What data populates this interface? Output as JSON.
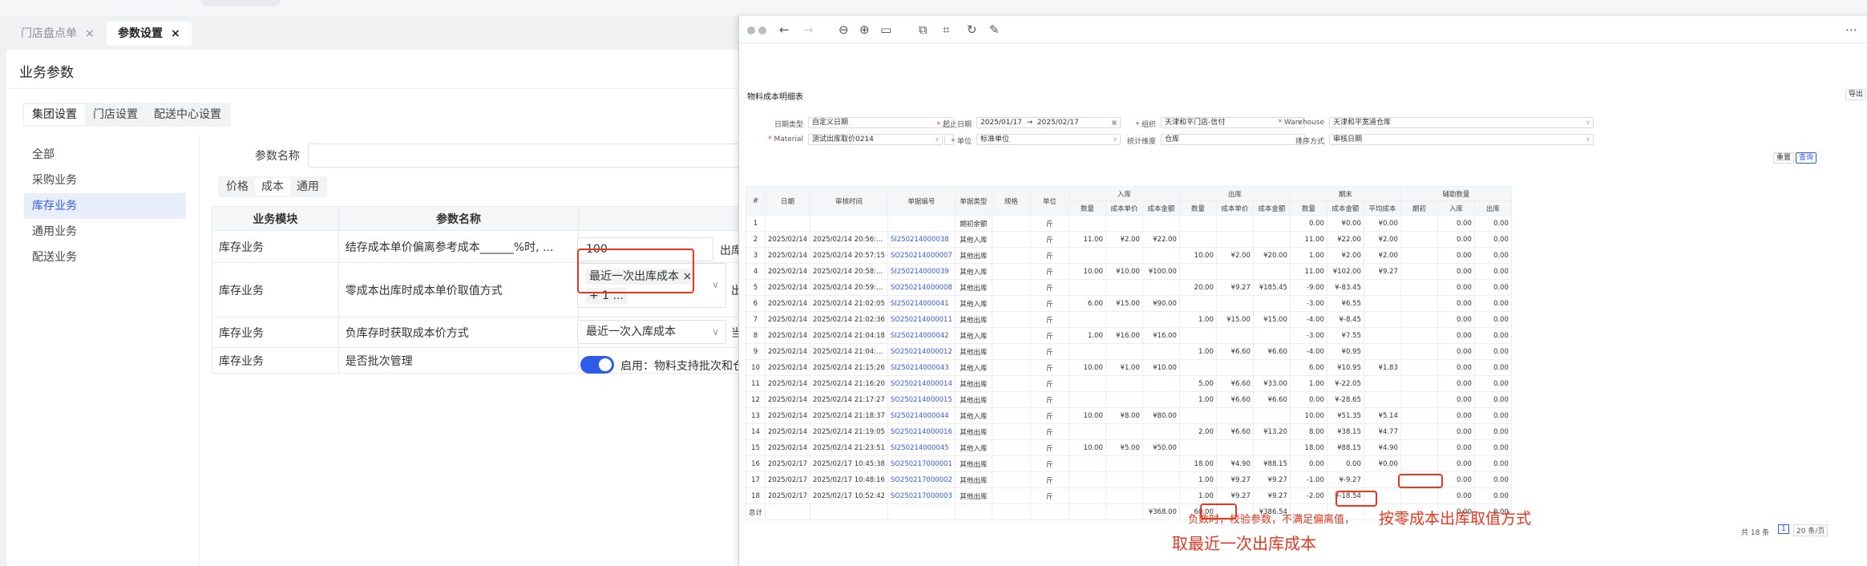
{
  "tabs": [
    {
      "label": "门店盘点单",
      "close": "×"
    },
    {
      "label": "参数设置",
      "close": "×"
    }
  ],
  "page": {
    "title": "业务参数",
    "scope_tabs": [
      "集团设置",
      "门店设置",
      "配送中心设置"
    ],
    "sidebar": [
      "全部",
      "采购业务",
      "库存业务",
      "通用业务",
      "配送业务"
    ],
    "param_name_label": "参数名称",
    "param_name_value": "",
    "sub_tabs": [
      "价格",
      "成本",
      "通用"
    ],
    "table": {
      "headers": [
        "业务模块",
        "参数名称"
      ],
      "rows": [
        {
          "module": "库存业务",
          "name": "结存成本单价偏离参考成本______%时, ..."
        },
        {
          "module": "库存业务",
          "name": "零成本出库时成本单价取值方式"
        },
        {
          "module": "库存业务",
          "name": "负库存时获取成本价方式"
        },
        {
          "module": "库存业务",
          "name": "是否批次管理"
        }
      ]
    },
    "row1_value": "100",
    "row1_after": "出库",
    "row2_tag": "最近一次出库成本",
    "row2_tag_close": "×",
    "row2_more": "+ 1 ...",
    "row2_after": "出",
    "row3_value": "最近一次入库成本",
    "row3_after": "当",
    "row4_text": "启用：物料支持批次和仓"
  },
  "report": {
    "title": "物料成本明细表",
    "export": "导出",
    "filters": {
      "date_type_label": "日期类型",
      "date_type": "自定义日期",
      "start_label": "起止日期",
      "start": "2025/01/17",
      "arrow": "→",
      "end": "2025/02/17",
      "org_label": "组织",
      "org": "天津和平门店-信付",
      "wh_label": "Warehouse",
      "wh": "天津和平宽道仓库",
      "mat_label": "Material",
      "mat": "测试出库取价0214",
      "unit_label": "单位",
      "unit": "标准单位",
      "dim_label": "统计维度",
      "dim": "仓库",
      "sort_label": "排序方式",
      "sort": "审核日期",
      "reset": "重置",
      "query": "查询"
    },
    "head_groups": {
      "in": "入库",
      "out": "出库",
      "end": "期末",
      "aux": "辅助数量"
    },
    "head_cols": [
      "#",
      "日期",
      "审核时间",
      "单据编号",
      "单据类型",
      "规格",
      "单位"
    ],
    "sub_cols": [
      "数量",
      "成本单价",
      "成本金额",
      "数量",
      "成本单价",
      "成本金额",
      "数量",
      "成本金额",
      "平均成本",
      "期初",
      "入库",
      "出库"
    ],
    "rows": [
      [
        "1",
        "",
        "",
        "",
        "期初余额",
        "",
        "斤",
        "",
        "",
        "",
        "",
        "",
        "",
        "0.00",
        "¥0.00",
        "¥0.00",
        "",
        "0.00",
        "0.00"
      ],
      [
        "2",
        "2025/02/14",
        "2025/02/14 20:56:...",
        "SI250214000038",
        "其他入库",
        "",
        "斤",
        "11.00",
        "¥2.00",
        "¥22.00",
        "",
        "",
        "",
        "11.00",
        "¥22.00",
        "¥2.00",
        "",
        "0.00",
        "0.00"
      ],
      [
        "3",
        "2025/02/14",
        "2025/02/14 20:57:15",
        "SO250214000007",
        "其他出库",
        "",
        "斤",
        "",
        "",
        "",
        "10.00",
        "¥2.00",
        "¥20.00",
        "1.00",
        "¥2.00",
        "¥2.00",
        "",
        "0.00",
        "0.00"
      ],
      [
        "4",
        "2025/02/14",
        "2025/02/14 20:58:...",
        "SI250214000039",
        "其他入库",
        "",
        "斤",
        "10.00",
        "¥10.00",
        "¥100.00",
        "",
        "",
        "",
        "11.00",
        "¥102.00",
        "¥9.27",
        "",
        "0.00",
        "0.00"
      ],
      [
        "5",
        "2025/02/14",
        "2025/02/14 20:59:...",
        "SO250214000008",
        "其他出库",
        "",
        "斤",
        "",
        "",
        "",
        "20.00",
        "¥9.27",
        "¥185.45",
        "-9.00",
        "¥-83.45",
        "",
        "",
        "0.00",
        "0.00"
      ],
      [
        "6",
        "2025/02/14",
        "2025/02/14 21:02:05",
        "SI250214000041",
        "其他入库",
        "",
        "斤",
        "6.00",
        "¥15.00",
        "¥90.00",
        "",
        "",
        "",
        "-3.00",
        "¥6.55",
        "",
        "",
        "0.00",
        "0.00"
      ],
      [
        "7",
        "2025/02/14",
        "2025/02/14 21:02:36",
        "SO250214000011",
        "其他出库",
        "",
        "斤",
        "",
        "",
        "",
        "1.00",
        "¥15.00",
        "¥15.00",
        "-4.00",
        "¥-8.45",
        "",
        "",
        "0.00",
        "0.00"
      ],
      [
        "8",
        "2025/02/14",
        "2025/02/14 21:04:18",
        "SI250214000042",
        "其他入库",
        "",
        "斤",
        "1.00",
        "¥16.00",
        "¥16.00",
        "",
        "",
        "",
        "-3.00",
        "¥7.55",
        "",
        "",
        "0.00",
        "0.00"
      ],
      [
        "9",
        "2025/02/14",
        "2025/02/14 21:04:...",
        "SO250214000012",
        "其他出库",
        "",
        "斤",
        "",
        "",
        "",
        "1.00",
        "¥6.60",
        "¥6.60",
        "-4.00",
        "¥0.95",
        "",
        "",
        "0.00",
        "0.00"
      ],
      [
        "10",
        "2025/02/14",
        "2025/02/14 21:15:26",
        "SI250214000043",
        "其他入库",
        "",
        "斤",
        "10.00",
        "¥1.00",
        "¥10.00",
        "",
        "",
        "",
        "6.00",
        "¥10.95",
        "¥1.83",
        "",
        "0.00",
        "0.00"
      ],
      [
        "11",
        "2025/02/14",
        "2025/02/14 21:16:20",
        "SO250214000014",
        "其他出库",
        "",
        "斤",
        "",
        "",
        "",
        "5.00",
        "¥6.60",
        "¥33.00",
        "1.00",
        "¥-22.05",
        "",
        "",
        "0.00",
        "0.00"
      ],
      [
        "12",
        "2025/02/14",
        "2025/02/14 21:17:27",
        "SO250214000015",
        "其他出库",
        "",
        "斤",
        "",
        "",
        "",
        "1.00",
        "¥6.60",
        "¥6.60",
        "0.00",
        "¥-28.65",
        "",
        "",
        "0.00",
        "0.00"
      ],
      [
        "13",
        "2025/02/14",
        "2025/02/14 21:18:37",
        "SI250214000044",
        "其他入库",
        "",
        "斤",
        "10.00",
        "¥8.00",
        "¥80.00",
        "",
        "",
        "",
        "10.00",
        "¥51.35",
        "¥5.14",
        "",
        "0.00",
        "0.00"
      ],
      [
        "14",
        "2025/02/14",
        "2025/02/14 21:19:05",
        "SO250214000016",
        "其他出库",
        "",
        "斤",
        "",
        "",
        "",
        "2.00",
        "¥6.60",
        "¥13.20",
        "8.00",
        "¥38.15",
        "¥4.77",
        "",
        "0.00",
        "0.00"
      ],
      [
        "15",
        "2025/02/14",
        "2025/02/14 21:23:51",
        "SI250214000045",
        "其他入库",
        "",
        "斤",
        "10.00",
        "¥5.00",
        "¥50.00",
        "",
        "",
        "",
        "18.00",
        "¥88.15",
        "¥4.90",
        "",
        "0.00",
        "0.00"
      ],
      [
        "16",
        "2025/02/17",
        "2025/02/17 10:45:38",
        "SO250217000001",
        "其他出库",
        "",
        "斤",
        "",
        "",
        "",
        "18.00",
        "¥4.90",
        "¥88.15",
        "0.00",
        "0.00",
        "¥0.00",
        "",
        "0.00",
        "0.00"
      ],
      [
        "17",
        "2025/02/17",
        "2025/02/17 10:48:16",
        "SO250217000002",
        "其他出库",
        "",
        "斤",
        "",
        "",
        "",
        "1.00",
        "¥9.27",
        "¥9.27",
        "-1.00",
        "¥-9.27",
        "",
        "",
        "0.00",
        "0.00"
      ],
      [
        "18",
        "2025/02/17",
        "2025/02/17 10:52:42",
        "SO250217000003",
        "其他出库",
        "",
        "斤",
        "",
        "",
        "",
        "1.00",
        "¥9.27",
        "¥9.27",
        "-2.00",
        "¥-18.54",
        "",
        "",
        "0.00",
        "0.00"
      ]
    ],
    "total": {
      "label": "总计",
      "in_amount": "¥368.00",
      "out_qty": "60.00",
      "out_amount": "¥386.54",
      "aux_in": "0.00",
      "aux_out": "0.00"
    },
    "pager": {
      "total": "共 18 条",
      "page": "1",
      "size": "20 条/页"
    }
  },
  "annotations": {
    "line1_small": "负数时，校验参数，不满足偏离值，",
    "line1_big": "按零成本出库取值方式",
    "line2": "取最近一次出库成本"
  },
  "colors": {
    "accent": "#2f5bea",
    "alert": "#e8361f"
  }
}
